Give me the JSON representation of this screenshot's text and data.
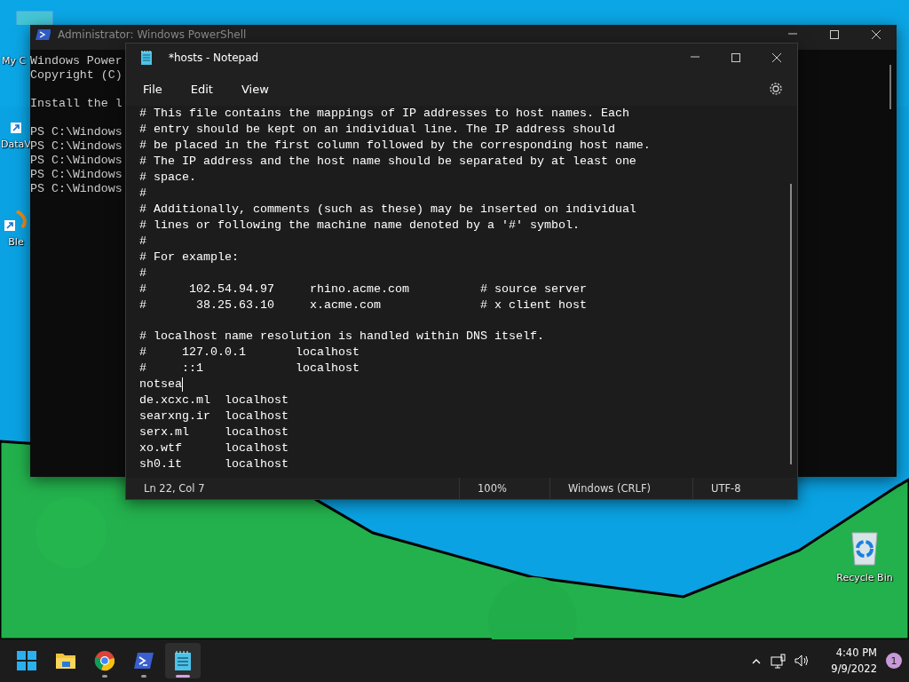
{
  "desktop_icons": [
    {
      "kind": "monitor",
      "label": "My C"
    },
    {
      "kind": "shortcut",
      "label": "DataV"
    },
    {
      "kind": "blender",
      "label": "Ble"
    },
    {
      "kind": "recycle",
      "label": "Recycle Bin"
    }
  ],
  "powershell": {
    "title": "Administrator: Windows PowerShell",
    "blocks": [
      [
        "Windows Power",
        "Copyright (C)"
      ],
      [
        "Install the l"
      ],
      [
        "PS C:\\Windows",
        "PS C:\\Windows",
        "PS C:\\Windows",
        "PS C:\\Windows",
        "PS C:\\Windows"
      ]
    ]
  },
  "notepad": {
    "title": "*hosts - Notepad",
    "menu": [
      "File",
      "Edit",
      "View"
    ],
    "blocks": [
      [
        {
          "text": "# This file contains the mappings of IP addresses to host names. Each",
          "caret": false
        },
        {
          "text": "# entry should be kept on an individual line. The IP address should",
          "caret": false
        },
        {
          "text": "# be placed in the first column followed by the corresponding host name.",
          "caret": false
        },
        {
          "text": "# The IP address and the host name should be separated by at least one",
          "caret": false
        },
        {
          "text": "# space.",
          "caret": false
        },
        {
          "text": "#",
          "caret": false
        },
        {
          "text": "# Additionally, comments (such as these) may be inserted on individual",
          "caret": false
        },
        {
          "text": "# lines or following the machine name denoted by a '#' symbol.",
          "caret": false
        },
        {
          "text": "#",
          "caret": false
        },
        {
          "text": "# For example:",
          "caret": false
        },
        {
          "text": "#",
          "caret": false
        },
        {
          "text": "#      102.54.94.97     rhino.acme.com          # source server",
          "caret": false
        },
        {
          "text": "#       38.25.63.10     x.acme.com              # x client host",
          "caret": false
        }
      ],
      [
        {
          "text": "# localhost name resolution is handled within DNS itself.",
          "caret": false
        },
        {
          "text": "#     127.0.0.1       localhost",
          "caret": false
        },
        {
          "text": "#     ::1             localhost",
          "caret": false
        },
        {
          "text": "notsea",
          "caret": true
        },
        {
          "text": "de.xcxc.ml  localhost",
          "caret": false
        },
        {
          "text": "searxng.ir  localhost",
          "caret": false
        },
        {
          "text": "serx.ml     localhost",
          "caret": false
        },
        {
          "text": "xo.wtf      localhost",
          "caret": false
        },
        {
          "text": "sh0.it      localhost",
          "caret": false
        }
      ]
    ],
    "status_bar": [
      "Ln 22, Col 7",
      "100%",
      "Windows (CRLF)",
      "UTF-8"
    ]
  },
  "taskbar": {
    "apps": [
      {
        "kind": "start",
        "running": false,
        "selected": false
      },
      {
        "kind": "folder",
        "running": false,
        "selected": false
      },
      {
        "kind": "browser",
        "running": true,
        "selected": false
      },
      {
        "kind": "terminal",
        "running": true,
        "selected": false
      },
      {
        "kind": "notepad",
        "running": true,
        "selected": true
      }
    ],
    "time": "4:40 PM",
    "date": "9/9/2022",
    "notification_count": "1"
  }
}
